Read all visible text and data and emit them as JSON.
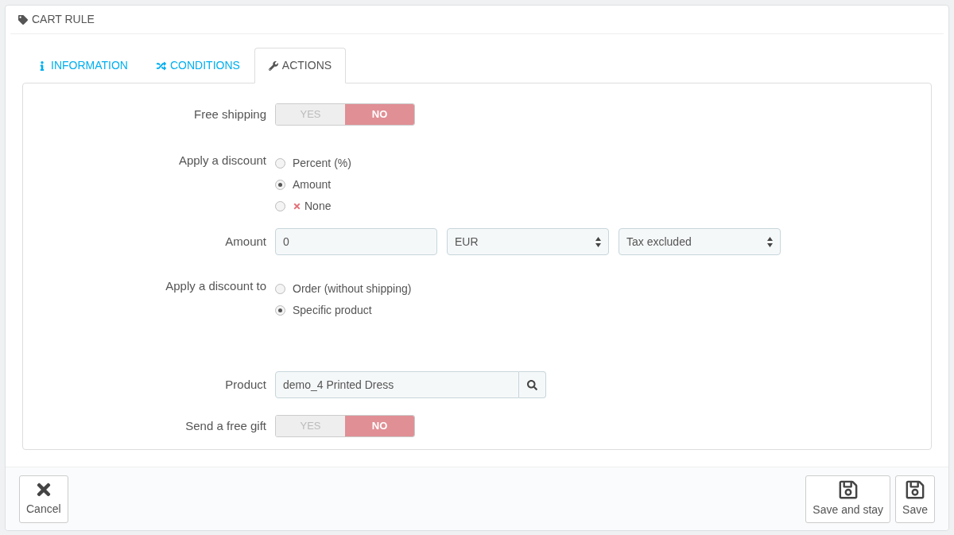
{
  "panel": {
    "title": "CART RULE"
  },
  "tabs": [
    {
      "label": "INFORMATION",
      "kind": "info",
      "selected": false
    },
    {
      "label": "CONDITIONS",
      "kind": "shuffle",
      "selected": false
    },
    {
      "label": "ACTIONS",
      "kind": "wrench",
      "selected": true
    }
  ],
  "fields": [
    {
      "kind": "switch",
      "label": "Free shipping",
      "options": [
        {
          "label": "YES",
          "selected": false
        },
        {
          "label": "NO",
          "selected": true
        }
      ]
    },
    {
      "kind": "radio",
      "label": "Apply a discount",
      "options": [
        {
          "label": "Percent (%)",
          "kind": "plain",
          "selected": false
        },
        {
          "label": "Amount",
          "kind": "plain",
          "selected": true
        },
        {
          "label": "None",
          "kind": "cross",
          "selected": false
        }
      ]
    },
    {
      "kind": "amount",
      "label": "Amount",
      "value": "0",
      "currency": "EUR",
      "tax": "Tax excluded"
    },
    {
      "kind": "radio",
      "label": "Apply a discount to",
      "options": [
        {
          "label": "Order (without shipping)",
          "kind": "plain",
          "selected": false
        },
        {
          "label": "Specific product",
          "kind": "plain",
          "selected": true
        }
      ]
    },
    {
      "kind": "search",
      "label": "Product",
      "value": "demo_4 Printed Dress"
    },
    {
      "kind": "switch",
      "label": "Send a free gift",
      "options": [
        {
          "label": "YES",
          "selected": false
        },
        {
          "label": "NO",
          "selected": true
        }
      ]
    }
  ],
  "footer": [
    {
      "label": "Cancel",
      "kind": "cancel"
    },
    {
      "label": "Save and stay",
      "kind": "save"
    },
    {
      "label": "Save",
      "kind": "save"
    }
  ]
}
